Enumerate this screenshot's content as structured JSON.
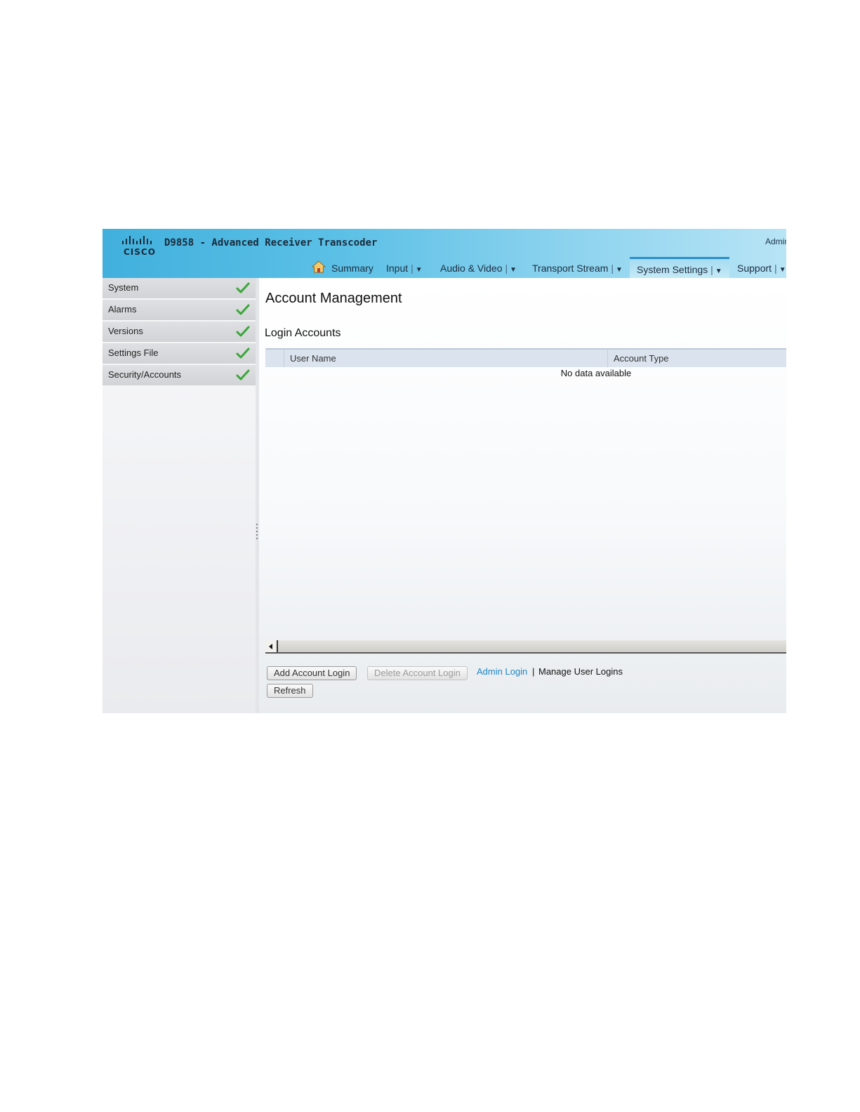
{
  "header": {
    "app_title": "D9858 - Advanced Receiver Transcoder",
    "logo_text": "CISCO",
    "user_label": "Admin"
  },
  "nav": {
    "items": [
      {
        "label": "Summary",
        "has_dropdown": false
      },
      {
        "label": "Input",
        "has_dropdown": true
      },
      {
        "label": "Audio & Video",
        "has_dropdown": true
      },
      {
        "label": "Transport Stream",
        "has_dropdown": true
      },
      {
        "label": "System Settings",
        "has_dropdown": true,
        "active": true
      },
      {
        "label": "Support",
        "has_dropdown": true
      }
    ],
    "separator": "|",
    "dropdown_glyph": "▼"
  },
  "sidebar": {
    "items": [
      {
        "label": "System",
        "status": "ok"
      },
      {
        "label": "Alarms",
        "status": "ok"
      },
      {
        "label": "Versions",
        "status": "ok"
      },
      {
        "label": "Settings File",
        "status": "ok"
      },
      {
        "label": "Security/Accounts",
        "status": "ok"
      }
    ],
    "status_icon": "green-check-icon"
  },
  "main": {
    "page_title": "Account Management",
    "section_title": "Login Accounts",
    "table": {
      "columns": [
        "User Name",
        "Account Type"
      ],
      "rows": [],
      "empty_message": "No data available"
    },
    "buttons": {
      "add": "Add Account Login",
      "delete": "Delete Account Login",
      "refresh": "Refresh"
    },
    "links": {
      "admin_login": "Admin Login",
      "separator": "|",
      "manage_user_logins": "Manage User Logins"
    }
  },
  "colors": {
    "header_gradient_start": "#41b0dd",
    "accent_link": "#1f86c7",
    "check_green": "#3aa63a"
  }
}
